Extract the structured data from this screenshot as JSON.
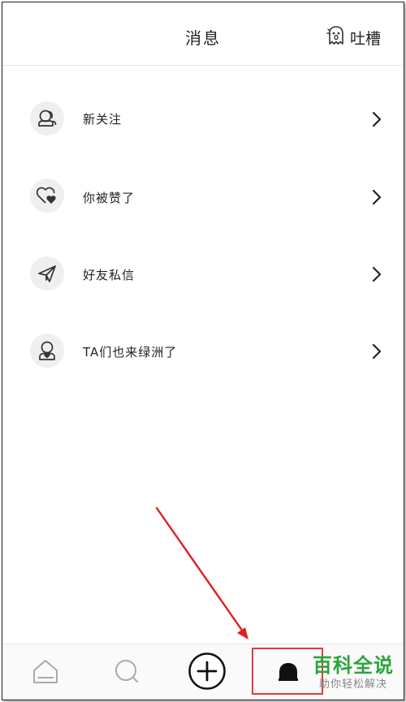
{
  "header": {
    "title": "消息",
    "complain_label": "吐槽"
  },
  "list": {
    "items": [
      {
        "label": "新关注",
        "icon": "users-icon"
      },
      {
        "label": "你被赞了",
        "icon": "heart-icon"
      },
      {
        "label": "好友私信",
        "icon": "paper-plane-icon"
      },
      {
        "label": "TA们也来绿洲了",
        "icon": "person-heart-icon"
      }
    ]
  },
  "tabbar": {
    "tabs": [
      "home-icon",
      "search-icon",
      "plus-icon",
      "bell-icon"
    ]
  },
  "watermark": {
    "main": "百科全说",
    "sub": "助你轻松解决"
  },
  "colors": {
    "highlight": "#e23a3a",
    "watermark": "#2aa53a"
  }
}
